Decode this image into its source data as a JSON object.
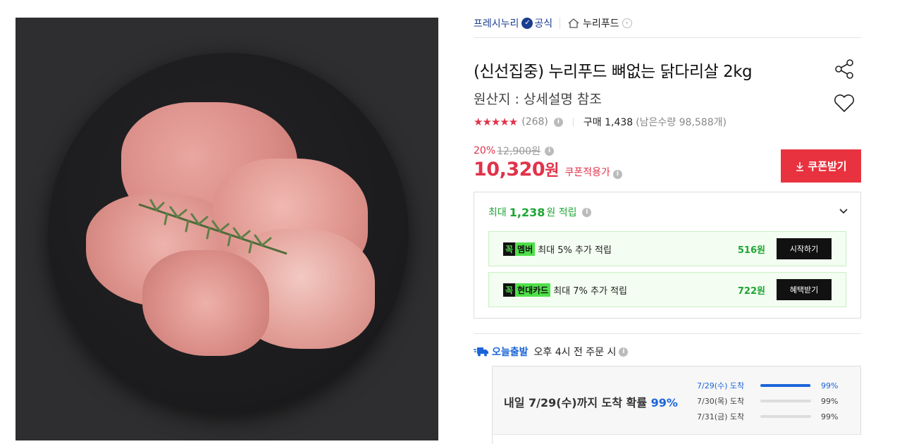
{
  "seller": {
    "brand": "프레시누리",
    "official": "공식",
    "store": "누리푸드"
  },
  "product": {
    "title": "(신선집중) 누리푸드 뼈없는 닭다리살 2kg",
    "origin": "원산지 : 상세설명 참조",
    "rating_stars": 4.5,
    "review_count": "(268)",
    "purchase": "구매 1,438",
    "remaining": "(남은수량 98,588개)"
  },
  "price": {
    "discount_pct": "20%",
    "original": "12,900원",
    "final_number": "10,320",
    "final_unit": "원",
    "coupon_applied": "쿠폰적용가",
    "coupon_button": "쿠폰받기"
  },
  "reward": {
    "prefix": "최대",
    "amount": "1,238",
    "suffix": "원 적립",
    "rows": [
      {
        "badge_k": "꼭",
        "badge_n": "멤버",
        "desc": "최대 5% 추가 적립",
        "amount": "516원",
        "action": "시작하기"
      },
      {
        "badge_k": "꼭",
        "badge_n": "현대카드",
        "desc": "최대 7% 추가 적립",
        "amount": "722원",
        "action": "혜택받기"
      }
    ]
  },
  "shipping": {
    "label": "오늘출발",
    "condition": "오후 4시 전 주문 시"
  },
  "arrival": {
    "text": "내일 7/29(수)까지 도착 확률",
    "prob": "99%",
    "rows": [
      {
        "date": "7/29(수) 도착",
        "pct": "99%",
        "fill": 0.99
      },
      {
        "date": "7/30(목) 도착",
        "pct": "99%",
        "fill": 0.0
      },
      {
        "date": "7/31(금) 도착",
        "pct": "99%",
        "fill": 0.0
      }
    ]
  },
  "colors": {
    "accent_red": "#e0334a",
    "brand_blue": "#1b3d8f",
    "green": "#1ea533",
    "blue": "#1b64d8"
  }
}
